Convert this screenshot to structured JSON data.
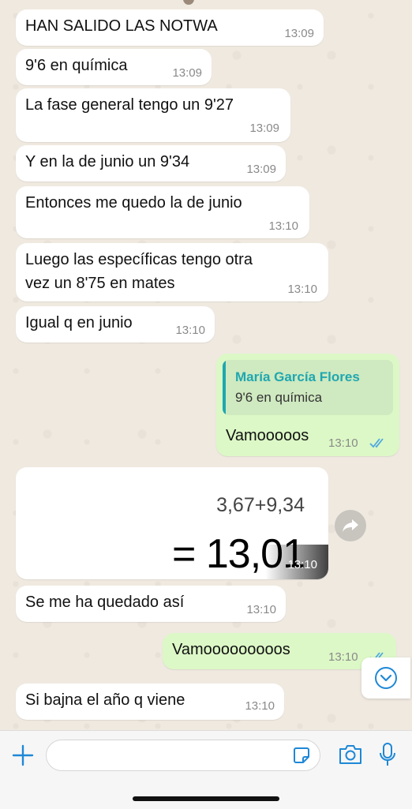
{
  "messages": [
    {
      "text": "HAN SALIDO LAS NOTWA",
      "time": "13:09"
    },
    {
      "text": "9'6 en química",
      "time": "13:09"
    },
    {
      "text": "La fase general tengo un 9'27",
      "time": "13:09"
    },
    {
      "text": "Y en la de junio un 9'34",
      "time": "13:09"
    },
    {
      "text": "Entonces me quedo la de junio",
      "time": "13:10"
    },
    {
      "text_line1": "Luego las específicas tengo otra",
      "text_line2": "vez un 8'75 en mates",
      "time": "13:10"
    },
    {
      "text": "Igual q en junio",
      "time": "13:10"
    },
    {
      "quote_name": "María García Flores",
      "quote_text": "9'6 en química",
      "text": "Vamooooos",
      "time": "13:10"
    },
    {
      "calc_expression": "3,67+9,34",
      "calc_result": "= 13,01",
      "time": "13:10"
    },
    {
      "text": "Se me ha quedado así",
      "time": "13:10"
    },
    {
      "text": "Vamooooooooos",
      "time": "13:10"
    },
    {
      "text": "Si bajna el año q viene",
      "time": "13:10"
    }
  ],
  "colors": {
    "incoming_bubble": "#ffffff",
    "outgoing_bubble": "#dcf8c6",
    "quote_accent": "#1fa7b0",
    "read_ticks": "#4fa8e0",
    "icon_blue": "#1e88d6"
  },
  "icons": {
    "plus": "plus-icon",
    "sticker": "sticker-icon",
    "camera": "camera-icon",
    "mic": "microphone-icon",
    "forward": "forward-icon",
    "scroll": "chevron-down-icon",
    "ticks": "double-check-icon"
  }
}
